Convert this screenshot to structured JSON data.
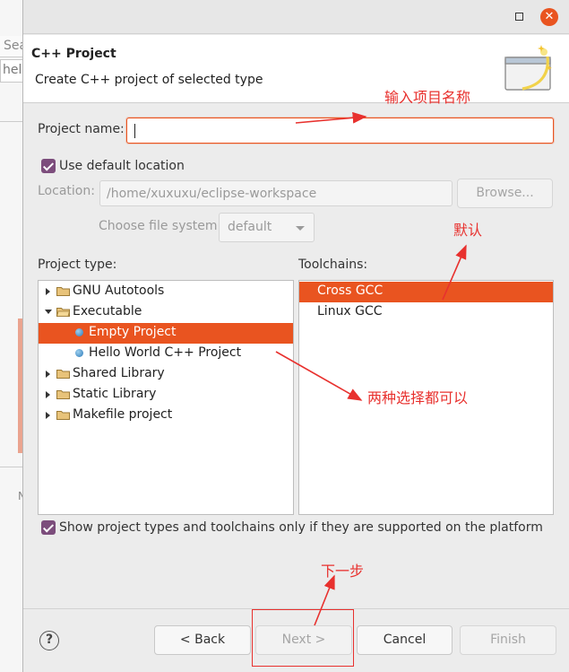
{
  "background": {
    "search_fragment": "Sea",
    "editor_fragment": "hell",
    "panel_fragment": "N"
  },
  "titlebar": {
    "minimize_icon": "minimize-icon",
    "close_icon": "close-icon"
  },
  "header": {
    "title": "C++ Project",
    "subtitle": "Create C++ project of selected type",
    "icon": "wizard-banner-icon"
  },
  "form": {
    "project_name_label": "Project name:",
    "project_name_value": "",
    "use_default_location_label": "Use default location",
    "use_default_location_checked": true,
    "location_label": "Location:",
    "location_value": "/home/xuxuxu/eclipse-workspace",
    "browse_label": "Browse...",
    "file_system_label": "Choose file system:",
    "file_system_value": "default"
  },
  "project_type": {
    "label": "Project type:",
    "items": [
      {
        "label": "GNU Autotools",
        "kind": "folder",
        "expanded": false
      },
      {
        "label": "Executable",
        "kind": "folder",
        "expanded": true
      },
      {
        "label": "Empty Project",
        "kind": "leaf",
        "selected": true
      },
      {
        "label": "Hello World C++ Project",
        "kind": "leaf",
        "selected": false
      },
      {
        "label": "Shared Library",
        "kind": "folder",
        "expanded": false
      },
      {
        "label": "Static Library",
        "kind": "folder",
        "expanded": false
      },
      {
        "label": "Makefile project",
        "kind": "folder",
        "expanded": false
      }
    ]
  },
  "toolchains": {
    "label": "Toolchains:",
    "items": [
      {
        "label": "Cross GCC",
        "selected": true
      },
      {
        "label": "Linux GCC",
        "selected": false
      }
    ]
  },
  "filter": {
    "label": "Show project types and toolchains only if they are supported on the platform",
    "checked": true
  },
  "footer": {
    "help_label": "?",
    "back_label": "< Back",
    "next_label": "Next >",
    "cancel_label": "Cancel",
    "finish_label": "Finish"
  },
  "annotations": {
    "enter_name": "输入项目名称",
    "default": "默认",
    "either_choice": "两种选择都可以",
    "next_step": "下一步",
    "color": "#e8312e"
  },
  "colors": {
    "accent": "#e95420",
    "checkbox": "#7c4d7c"
  }
}
